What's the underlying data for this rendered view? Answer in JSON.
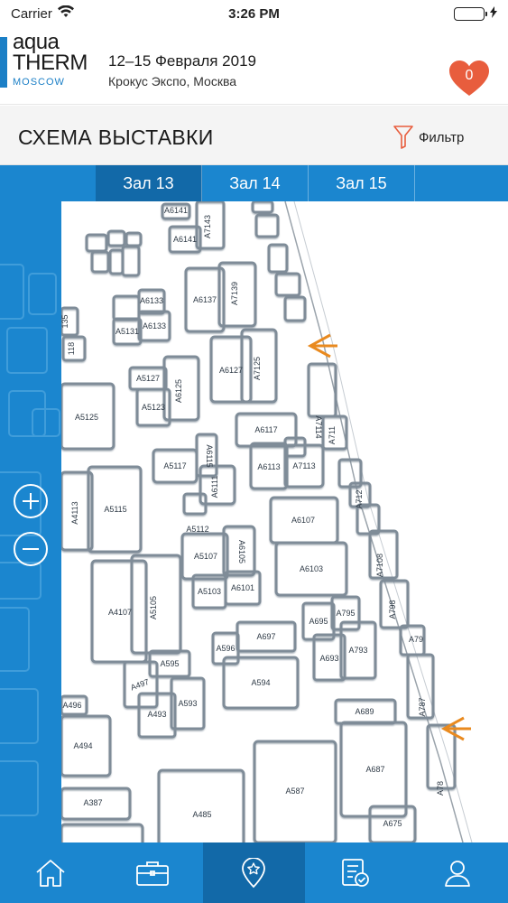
{
  "status": {
    "carrier": "Carrier",
    "time": "3:26 PM"
  },
  "event": {
    "logo": {
      "line1": "aqua",
      "line2": "THERM",
      "line3": "MOSCOW"
    },
    "date": "12–15 Февраля 2019",
    "venue": "Крокус Экспо, Москва",
    "favorites_count": "0"
  },
  "page": {
    "title": "СХЕМА ВЫСТАВКИ",
    "filter_label": "Фильтр"
  },
  "halls": [
    {
      "label": "Зал 13",
      "active": true
    },
    {
      "label": "Зал 14",
      "active": false
    },
    {
      "label": "Зал 15",
      "active": false
    }
  ],
  "booths": {
    "a6141": "A6141",
    "a7143": "A7143",
    "a6137": "A6137",
    "a7139": "A7139",
    "a5131": "A5131",
    "a6133": "A6133",
    "a6127": "A6127",
    "a7125": "A7125",
    "a5127": "A5127",
    "a6125": "A6125",
    "a5123": "A5123",
    "a5125": "A5125",
    "a6117": "A6117",
    "a7114": "A7114",
    "a5117": "A5117",
    "a6115": "A6115",
    "a6113": "A6113",
    "a7113": "A7113",
    "a6111": "A6111",
    "a5112": "A5112",
    "a4113": "A4113",
    "a5115": "A5115",
    "a6107": "A6107",
    "a6103": "A6103",
    "a7108": "A7108",
    "a5107": "A5107",
    "a6105": "A6105",
    "a5103": "A5103",
    "a6101": "A6101",
    "a4107": "A4107",
    "a5105": "A5105",
    "a695": "A695",
    "a795": "A795",
    "a693": "A693",
    "a793": "A793",
    "a596": "A596",
    "a697": "A697",
    "a595": "A595",
    "a497": "A497",
    "a493": "A493",
    "a593": "A593",
    "a594": "A594",
    "a496": "A496",
    "a494": "A494",
    "a689": "A689",
    "a687": "A687",
    "a587": "A587",
    "a485": "A485",
    "a387": "A387",
    "a675": "A675",
    "a787": "A787",
    "a78": "A78",
    "a79": "A79",
    "a798": "A798",
    "a711": "A711",
    "a712": "A712",
    "a118": "118",
    "a135": "135"
  },
  "nav": [
    {
      "icon": "home-icon",
      "active": false
    },
    {
      "icon": "briefcase-icon",
      "active": false
    },
    {
      "icon": "map-pin-star-icon",
      "active": true
    },
    {
      "icon": "checklist-icon",
      "active": false
    },
    {
      "icon": "profile-icon",
      "active": false
    }
  ],
  "colors": {
    "brand": "#1b86cf",
    "brand_dark": "#1269a8",
    "accent": "#e85d3d",
    "arrow": "#e98a1f"
  }
}
